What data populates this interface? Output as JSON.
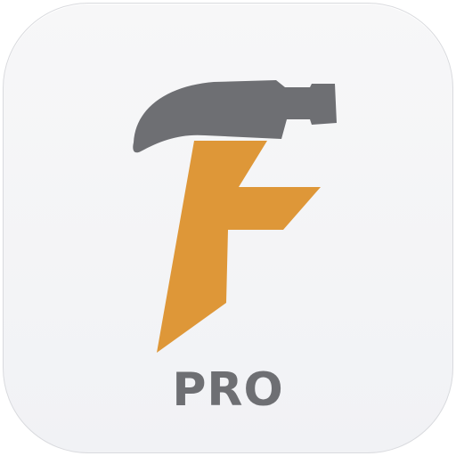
{
  "app_icon": {
    "badge_text": "PRO",
    "logo_letter": "F",
    "icon_names": [
      "hammer-icon",
      "f-letter-logo"
    ],
    "colors": {
      "tile_background": "#f4f5f7",
      "tile_border": "#d9dade",
      "hammer": "#6e6f73",
      "letter_f": "#de9738",
      "badge_text": "#6e6f73"
    }
  }
}
